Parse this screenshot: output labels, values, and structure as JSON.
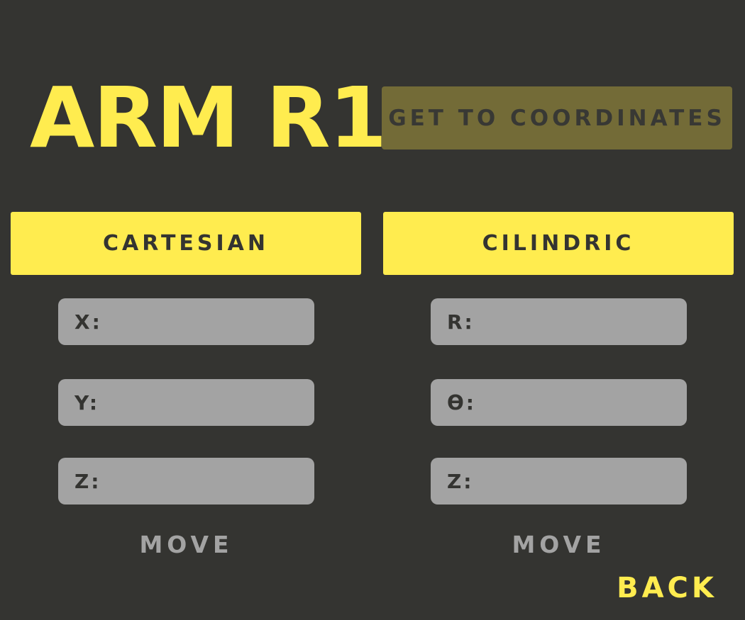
{
  "header": {
    "title": "ARM R1",
    "get_coordinates_label": "GET TO COORDINATES"
  },
  "cartesian": {
    "mode_label": "CARTESIAN",
    "fields": [
      {
        "label": "X:",
        "value": ""
      },
      {
        "label": "Y:",
        "value": ""
      },
      {
        "label": "Z:",
        "value": ""
      }
    ],
    "move_label": "MOVE"
  },
  "cilindric": {
    "mode_label": "CILINDRIC",
    "fields": [
      {
        "label": "R:",
        "value": ""
      },
      {
        "label": "ϴ:",
        "value": ""
      },
      {
        "label": "Z:",
        "value": ""
      }
    ],
    "move_label": "MOVE"
  },
  "footer": {
    "back_label": "BACK"
  },
  "colors": {
    "background": "#343431",
    "accent_yellow": "#ffec4f",
    "dim_yellow": "#736b37",
    "field_gray": "#a3a3a3",
    "dark_text": "#343431"
  }
}
